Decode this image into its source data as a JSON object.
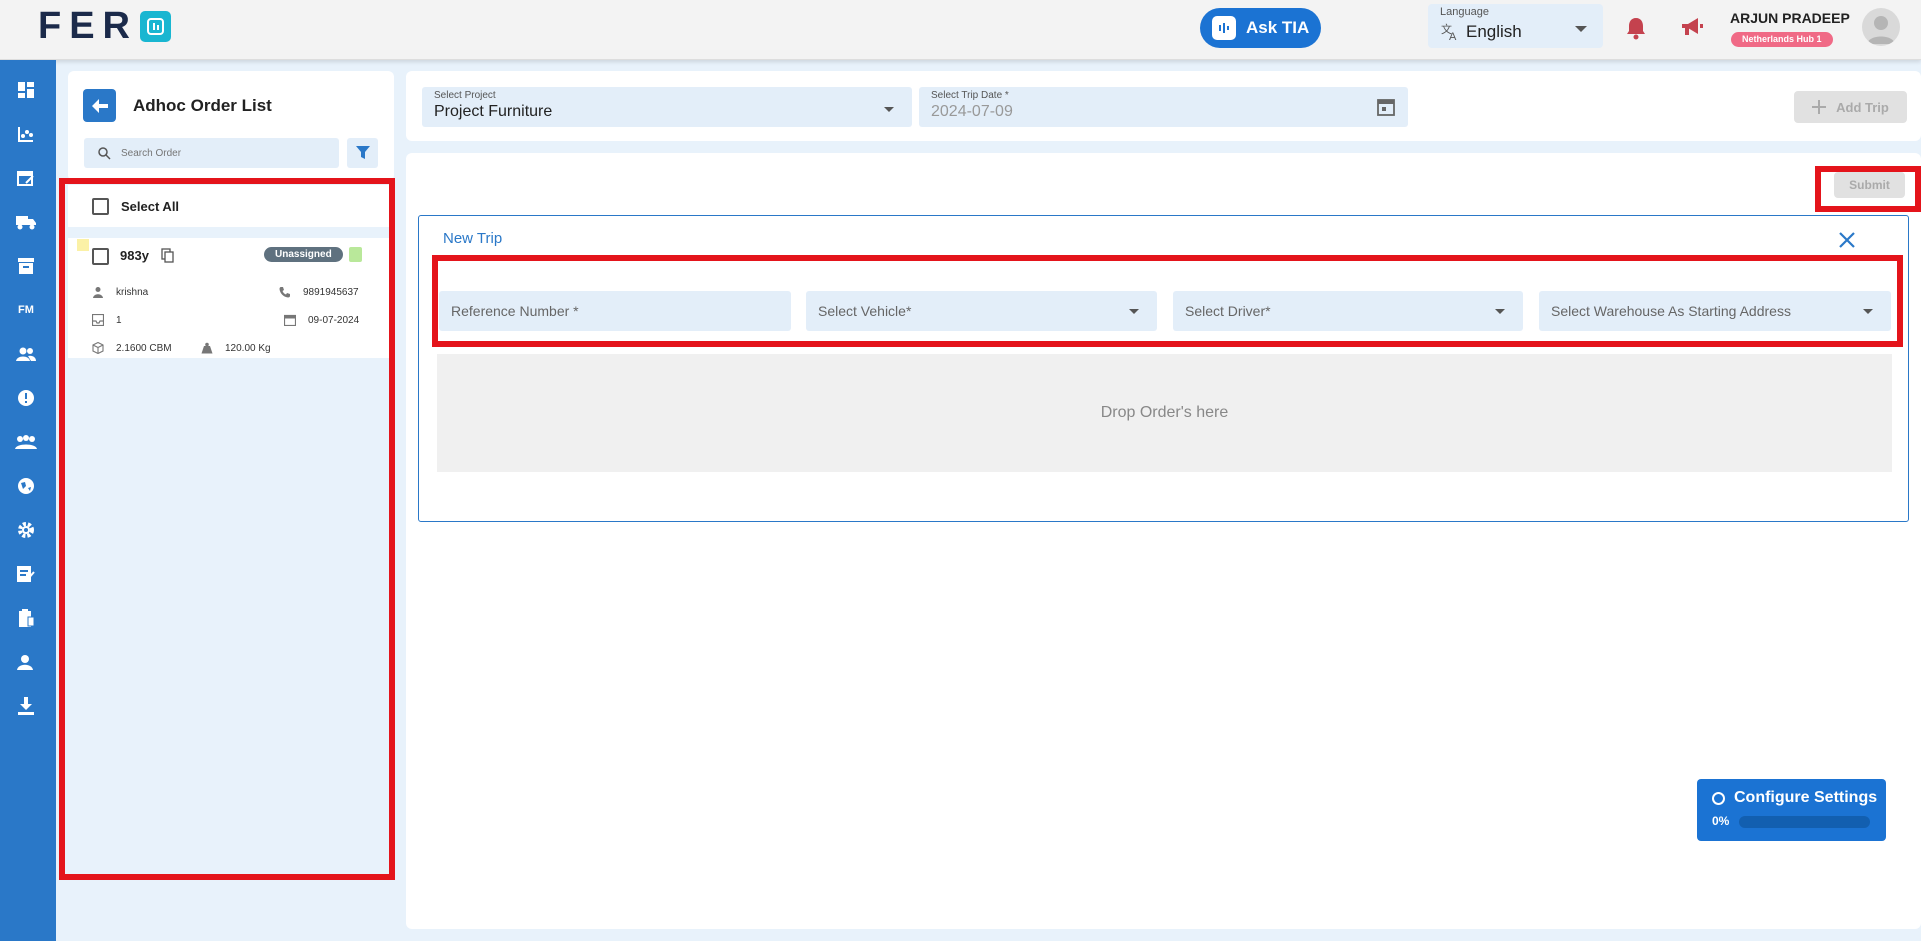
{
  "app": {
    "logo_text": "FER",
    "ask_tia_label": "Ask TIA"
  },
  "language": {
    "label": "Language",
    "value": "English"
  },
  "user": {
    "name": "ARJUN PRADEEP",
    "hub": "Netherlands Hub 1"
  },
  "order_panel": {
    "title": "Adhoc Order List",
    "search_placeholder": "Search Order",
    "select_all_label": "Select All",
    "orders": [
      {
        "id": "983y",
        "status": "Unassigned",
        "customer": "krishna",
        "phone": "9891945637",
        "quantity": "1",
        "date": "09-07-2024",
        "volume": "2.1600 CBM",
        "weight": "120.00 Kg"
      }
    ]
  },
  "project_bar": {
    "project_label": "Select Project",
    "project_value": "Project Furniture",
    "date_label": "Select Trip Date *",
    "date_value": "2024-07-09",
    "add_trip_label": "Add Trip"
  },
  "trip": {
    "submit_label": "Submit",
    "title": "New Trip",
    "reference_placeholder": "Reference Number *",
    "vehicle_placeholder": "Select Vehicle*",
    "driver_placeholder": "Select Driver*",
    "warehouse_placeholder": "Select Warehouse As Starting Address",
    "drop_text": "Drop Order's here"
  },
  "configure": {
    "title": "Configure Settings",
    "progress_label": "0%",
    "progress_fraction": 0
  },
  "colors": {
    "primary": "#2a78c8",
    "accent": "#1b73d3",
    "highlight": "#e4141b",
    "badge_pink": "#f06a86",
    "field_bg": "#e3eef9"
  }
}
